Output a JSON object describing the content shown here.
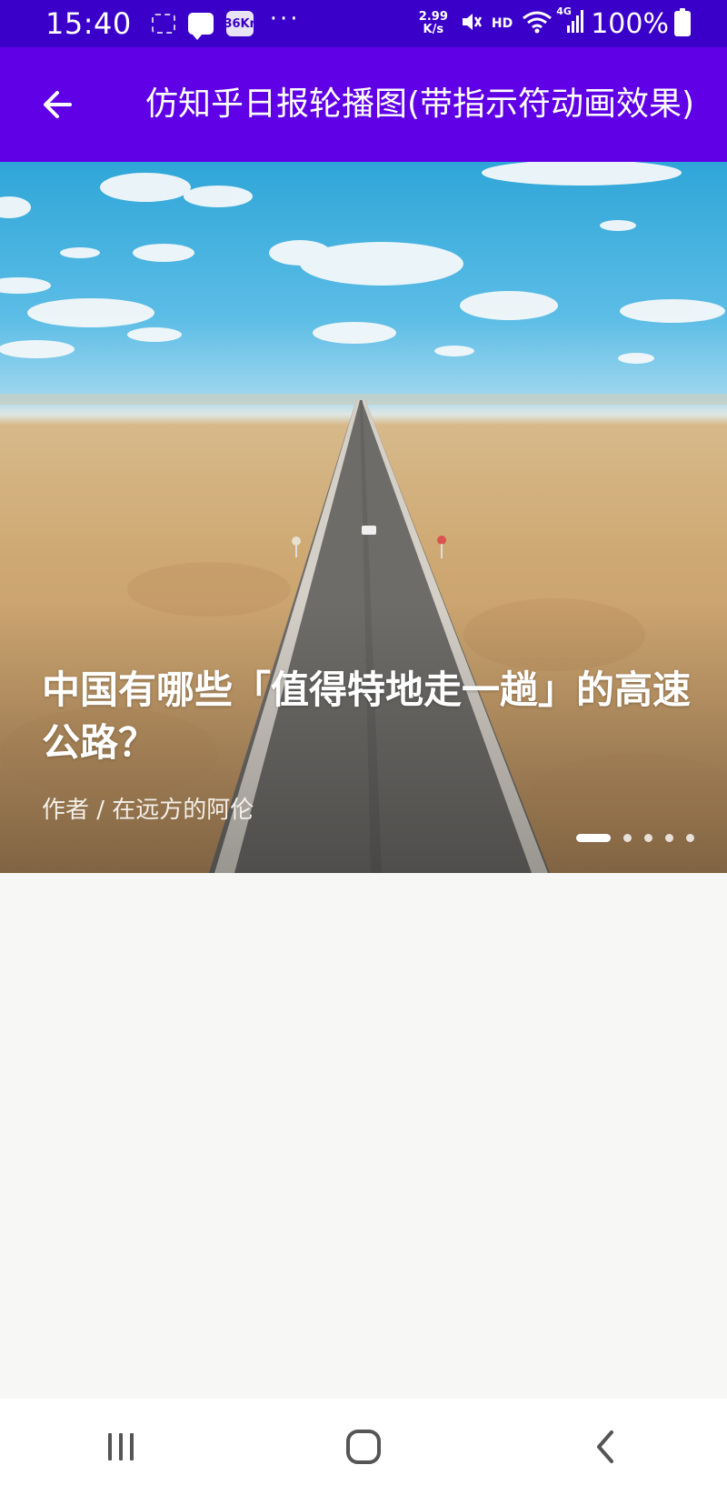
{
  "status_bar": {
    "time": "15:40",
    "kr_badge": "36Kr",
    "more": "···",
    "speed_value": "2.99",
    "speed_unit": "K/s",
    "hd": "HD",
    "network": "4G",
    "battery": "100%"
  },
  "app_bar": {
    "title": "仿知乎日报轮播图(带指示符动画效果)"
  },
  "banner": {
    "title": "中国有哪些「值得特地走一趟」的高速公路？",
    "author": "作者 / 在远方的阿伦",
    "page_count": 5,
    "active_index": 0
  },
  "colors": {
    "status_bar": "#3a00c9",
    "app_bar": "#5f00e6",
    "background": "#f7f8f5"
  },
  "icons": {
    "back": "arrow-left-icon",
    "recents": "recents-icon",
    "home": "home-icon",
    "nav_back": "chevron-left-icon"
  }
}
